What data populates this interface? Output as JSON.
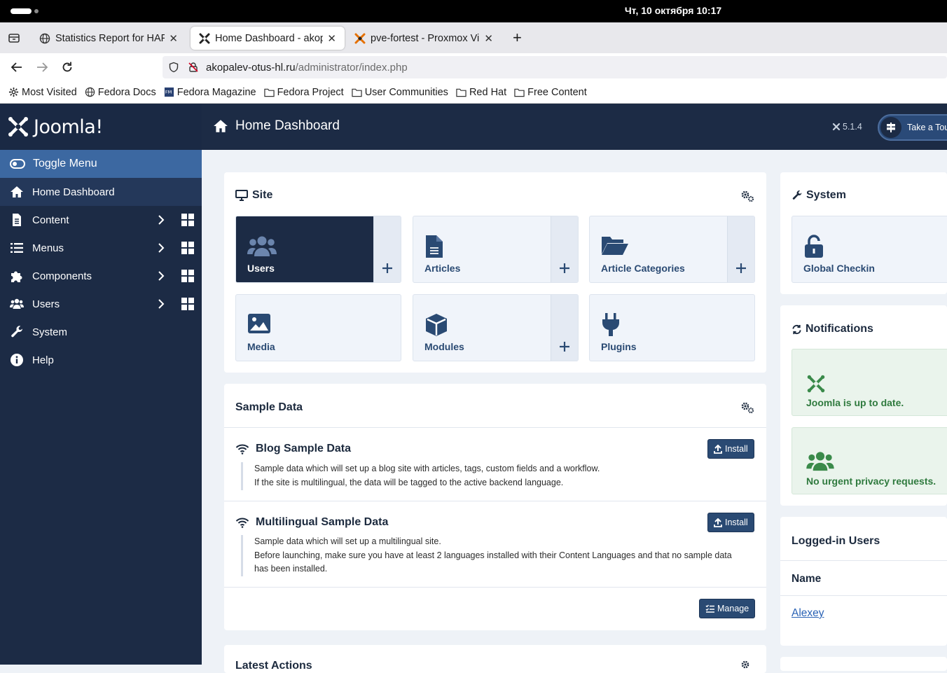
{
  "os": {
    "clock": "Чт, 10 октября  10:17"
  },
  "browser": {
    "tabs": [
      {
        "label": "Statistics Report for HAPr",
        "active": false
      },
      {
        "label": "Home Dashboard - akopal",
        "active": true
      },
      {
        "label": "pve-fortest - Proxmox Virt",
        "active": false
      }
    ],
    "new_tab": "+",
    "url": {
      "host": "akopalev-otus-hl.ru",
      "path": "/administrator/index.php"
    },
    "bookmarks": [
      "Most Visited",
      "Fedora Docs",
      "Fedora Magazine",
      "Fedora Project",
      "User Communities",
      "Red Hat",
      "Free Content"
    ]
  },
  "sidebar": {
    "logo_text": "Joomla!",
    "toggle_label": "Toggle Menu",
    "items": [
      {
        "label": "Home Dashboard",
        "icon": "home-icon",
        "active": true
      },
      {
        "label": "Content",
        "icon": "file-icon",
        "expandable": true
      },
      {
        "label": "Menus",
        "icon": "list-icon",
        "expandable": true
      },
      {
        "label": "Components",
        "icon": "puzzle-icon",
        "expandable": true
      },
      {
        "label": "Users",
        "icon": "users-icon",
        "expandable": true
      },
      {
        "label": "System",
        "icon": "wrench-icon"
      },
      {
        "label": "Help",
        "icon": "info-icon"
      }
    ]
  },
  "header": {
    "title": "Home Dashboard",
    "version": "5.1.4",
    "tour_label": "Take a Tour"
  },
  "site": {
    "title": "Site",
    "tiles": [
      {
        "label": "Users",
        "icon": "users-icon",
        "add": true
      },
      {
        "label": "Articles",
        "icon": "file-icon",
        "add": true
      },
      {
        "label": "Article Categories",
        "icon": "folder-open-icon",
        "add": true
      },
      {
        "label": "Media",
        "icon": "image-icon",
        "add": false
      },
      {
        "label": "Modules",
        "icon": "cube-icon",
        "add": true
      },
      {
        "label": "Plugins",
        "icon": "plug-icon",
        "add": false
      }
    ]
  },
  "system_card": {
    "title": "System",
    "tile_label": "Global Checkin"
  },
  "sample_data": {
    "title": "Sample Data",
    "items": [
      {
        "title": "Blog Sample Data",
        "lines": [
          "Sample data which will set up a blog site with articles, tags, custom fields and a workflow.",
          "If the site is multilingual, the data will be tagged to the active backend language."
        ],
        "button": "Install"
      },
      {
        "title": "Multilingual Sample Data",
        "lines": [
          "Sample data which will set up a multilingual site.",
          "Before launching, make sure you have at least 2 languages installed with their Content Languages and that no sample data has been installed."
        ],
        "button": "Install"
      }
    ],
    "manage_label": "Manage"
  },
  "latest_actions": {
    "title": "Latest Actions"
  },
  "notifications": {
    "title": "Notifications",
    "items": [
      "Joomla is up to date.",
      "No urgent privacy requests."
    ]
  },
  "logged_in": {
    "title": "Logged-in Users",
    "column": "Name",
    "users": [
      "Alexey"
    ]
  },
  "colors": {
    "nav_dark": "#1c2b45",
    "toggle_blue": "#3c68a1",
    "button": "#2a4a73",
    "success": "#2f7a3e"
  }
}
